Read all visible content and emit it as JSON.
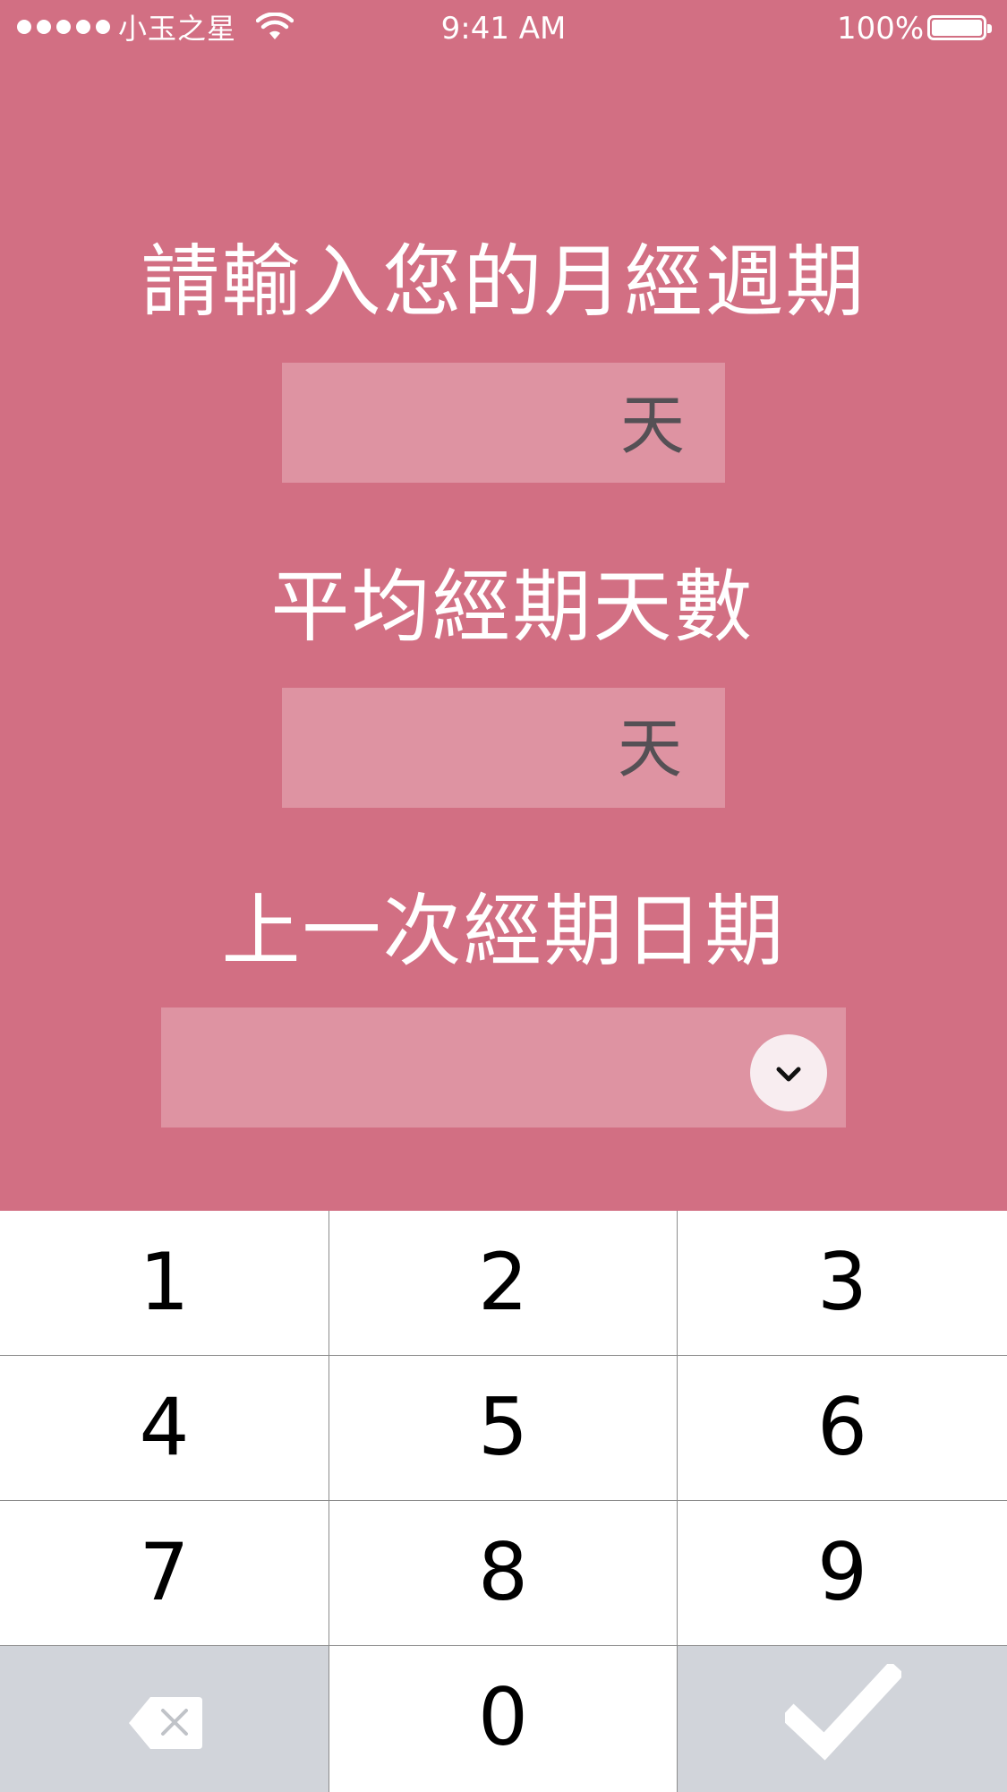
{
  "status_bar": {
    "carrier": "小玉之星",
    "time": "9:41 AM",
    "battery_percent": "100%"
  },
  "form": {
    "cycle_label": "請輸入您的月經週期",
    "cycle_unit": "天",
    "period_length_label": "平均經期天數",
    "period_length_unit": "天",
    "last_period_label": "上一次經期日期"
  },
  "keypad": {
    "keys": [
      "1",
      "2",
      "3",
      "4",
      "5",
      "6",
      "7",
      "8",
      "9",
      "0"
    ]
  },
  "icons": {
    "dropdown": "chevron-down-icon",
    "delete": "backspace-icon",
    "confirm": "checkmark-icon"
  },
  "colors": {
    "background": "#D26F83",
    "field": "#DE93A2",
    "keypad_gray": "#D1D4DA"
  }
}
